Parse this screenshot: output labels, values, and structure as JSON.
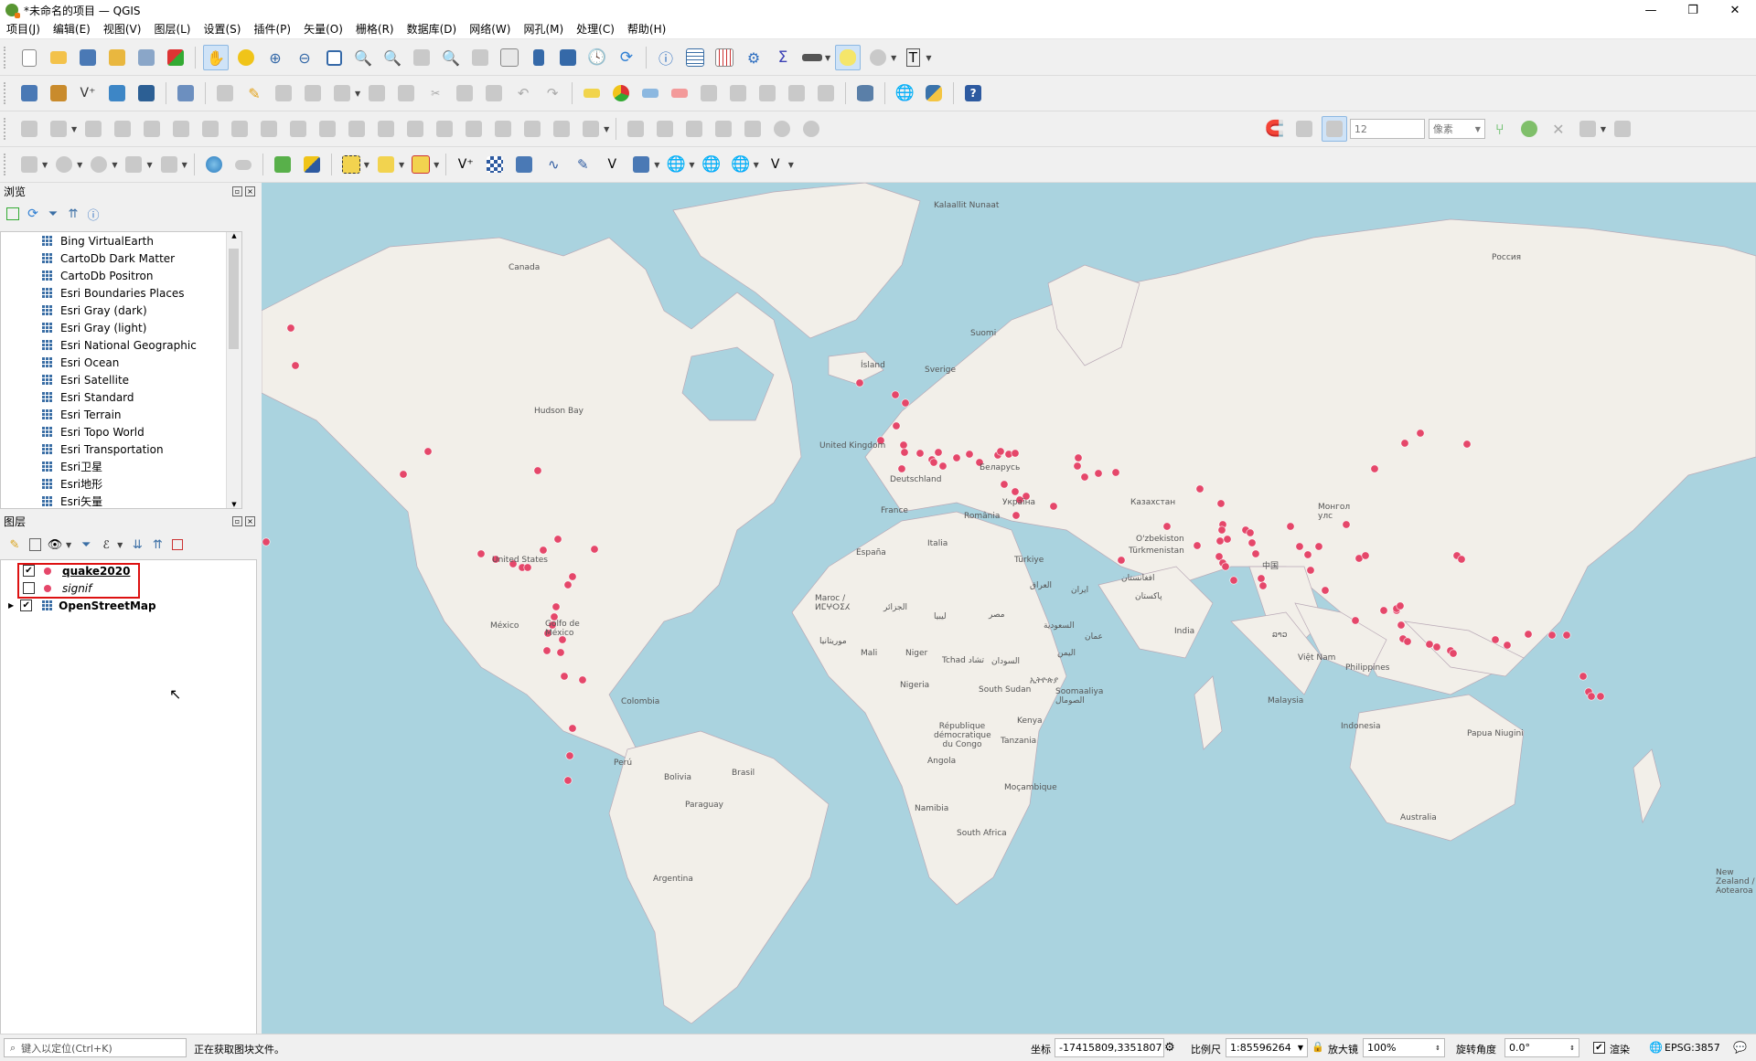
{
  "window": {
    "title": "*未命名的项目 — QGIS",
    "minimize": "—",
    "maximize": "❐",
    "close": "✕"
  },
  "menu": [
    "项目(J)",
    "编辑(E)",
    "视图(V)",
    "图层(L)",
    "设置(S)",
    "插件(P)",
    "矢量(O)",
    "栅格(R)",
    "数据库(D)",
    "网络(W)",
    "网孔(M)",
    "处理(C)",
    "帮助(H)"
  ],
  "toolbar3": {
    "snap_size": "12",
    "snap_unit": "像素"
  },
  "browser": {
    "title": "浏览",
    "items": [
      "Bing VirtualEarth",
      "CartoDb Dark Matter",
      "CartoDb Positron",
      "Esri Boundaries Places",
      "Esri Gray (dark)",
      "Esri Gray (light)",
      "Esri National Geographic",
      "Esri Ocean",
      "Esri Satellite",
      "Esri Standard",
      "Esri Terrain",
      "Esri Topo World",
      "Esri Transportation",
      "Esri卫星",
      "Esri地形",
      "Esri矢量"
    ]
  },
  "layers": {
    "title": "图层",
    "items": [
      {
        "name": "quake2020",
        "checked": true
      },
      {
        "name": "signif",
        "checked": false
      },
      {
        "name": "OpenStreetMap",
        "checked": true
      }
    ]
  },
  "map_labels": {
    "kalaallit": "Kalaallit Nunaat",
    "canada": "Canada",
    "island": "Ísland",
    "hudson": "Hudson Bay",
    "uk": "United Kingdom",
    "sverige": "Sverige",
    "suomi": "Suomi",
    "rossiya": "Россия",
    "deutschland": "Deutschland",
    "belarus": "Беларусь",
    "ukraina": "Україна",
    "france": "France",
    "romania": "România",
    "italia": "Italia",
    "espana": "España",
    "turkiye": "Türkiye",
    "kazakhstan": "Казахстан",
    "mongol": "Монгол улс",
    "uzbekiston": "O'zbekiston",
    "turkmenistan": "Türkmenistan",
    "us": "United States",
    "mexico": "México",
    "golfo": "Golfo de México",
    "maroc": "Maroc / ⵍⵎⵖⵔⵉⵃ",
    "china": "中国",
    "india": "India",
    "iran": "ایران",
    "iraq": "العراق",
    "afghanistan": "افغانستان",
    "pakistan": "پاکستان",
    "saudi": "السعودية",
    "egypt": "مصر",
    "libya": "ليبيا",
    "algeria": "الجزائر",
    "mali": "Mali",
    "niger": "Niger",
    "tchad": "Tchad تشاد",
    "sudan": "السودان",
    "nigeria": "Nigeria",
    "ethiopia": "ኢትዮጵያ",
    "southsudan": "South Sudan",
    "somalia": "Soomaaliya الصومال",
    "kenya": "Kenya",
    "tanzania": "Tanzania",
    "rdc": "République démocratique du Congo",
    "angola": "Angola",
    "namibia": "Namibia",
    "mozambique": "Moçambique",
    "southafrica": "South Africa",
    "yemen": "اليمن",
    "oman": "عمان",
    "colombia": "Colombia",
    "peru": "Perú",
    "brasil": "Brasil",
    "bolivia": "Bolivia",
    "paraguay": "Paraguay",
    "argentina": "Argentina",
    "vietnam": "Việt Nam",
    "laos": "ລາວ",
    "philippines": "Philippines",
    "malaysia": "Malaysia",
    "indonesia": "Indonesia",
    "png": "Papua Niugini",
    "australia": "Australia",
    "nz": "New Zealand / Aotearoa",
    "mauritania": "موريتانيا"
  },
  "status": {
    "search_placeholder": "键入以定位(Ctrl+K)",
    "message": "正在获取图块文件。",
    "coord_label": "坐标",
    "coord_value": "-17415809,3351807",
    "scale_label": "比例尺",
    "scale_value": "1:85596264",
    "magnifier_label": "放大镜",
    "magnifier_value": "100%",
    "rotation_label": "旋转角度",
    "rotation_value": "0.0°",
    "render_label": "渲染",
    "crs": "EPSG:3857"
  },
  "colors": {
    "point": "#e5476a",
    "water": "#aad3df",
    "land": "#f2efe9"
  }
}
